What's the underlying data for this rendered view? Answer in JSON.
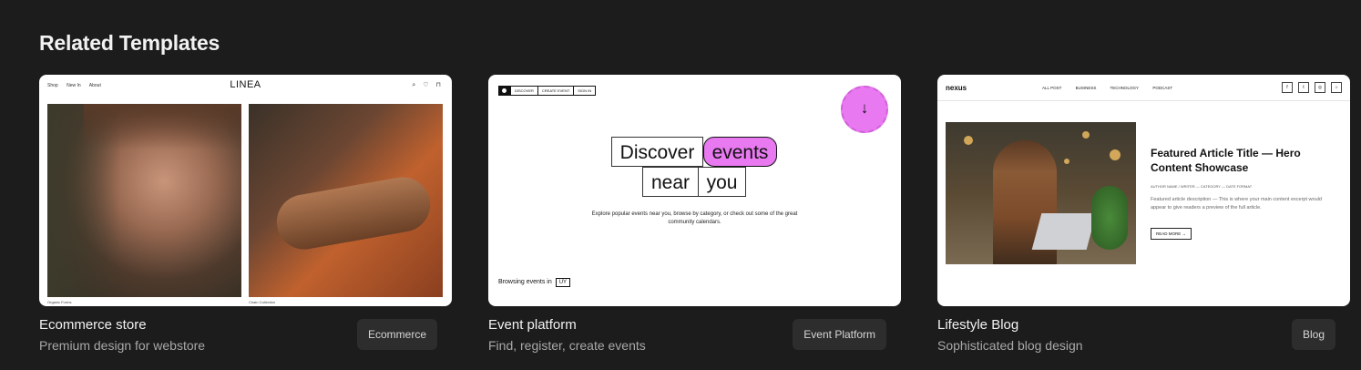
{
  "heading": "Related Templates",
  "cards": [
    {
      "title": "Ecommerce store",
      "subtitle": "Premium design for webstore",
      "tag": "Ecommerce",
      "preview": {
        "nav": [
          "Shop",
          "New In",
          "About"
        ],
        "logo": "LINEA",
        "captions": [
          "Organic Forms",
          "Chain Collection"
        ]
      }
    },
    {
      "title": "Event platform",
      "subtitle": "Find, register, create events",
      "tag": "Event Platform",
      "preview": {
        "nav": [
          "DISCOVER",
          "CREATE EVENT",
          "SIGN IN"
        ],
        "headline": [
          "Discover",
          "events",
          "near",
          "you"
        ],
        "description": "Explore popular events near you, browse by category, or check out some of the great community calendars.",
        "browse_label": "Browsing events in",
        "region": "UY"
      }
    },
    {
      "title": "Lifestyle Blog",
      "subtitle": "Sophisticated blog design",
      "tag": "Blog",
      "preview": {
        "logo": "nexus",
        "menu": [
          "ALL POST",
          "BUSINESS",
          "TECHNOLOGY",
          "PODCAST"
        ],
        "featured_title": "Featured Article Title — Hero Content Showcase",
        "featured_meta": "AUTHOR NAME / WRITER — CATEGORY — DATE FORMAT",
        "featured_desc": "Featured article description — This is where your main content excerpt would appear to give readers a preview of the full article.",
        "read_more": "READ MORE →"
      }
    }
  ]
}
